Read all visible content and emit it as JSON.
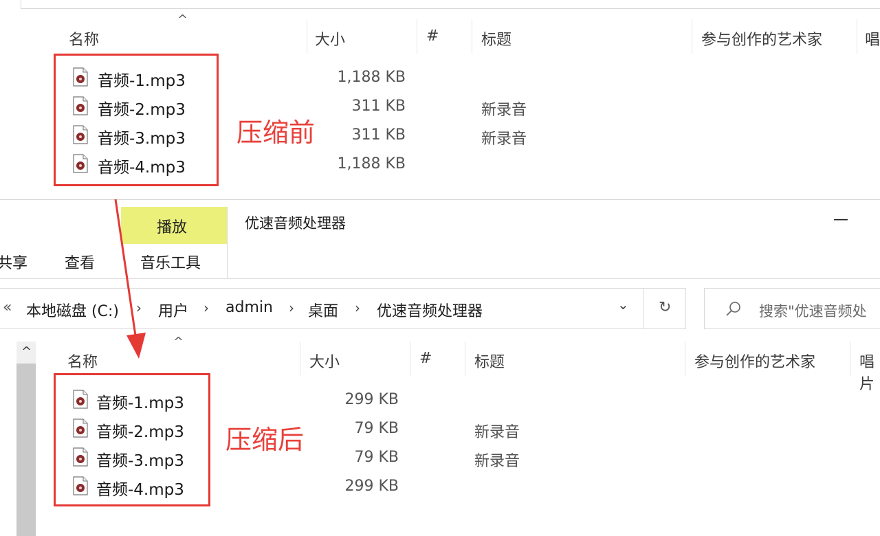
{
  "top_window": {
    "columns": {
      "name": "名称",
      "size": "大小",
      "number": "#",
      "title": "标题",
      "artist": "参与创作的艺术家",
      "extra": "唱"
    },
    "sort_indicator": "^",
    "files": [
      {
        "name": "音频-1.mp3",
        "size": "1,188 KB",
        "title": ""
      },
      {
        "name": "音频-2.mp3",
        "size": "311 KB",
        "title": "新录音"
      },
      {
        "name": "音频-3.mp3",
        "size": "311 KB",
        "title": "新录音"
      },
      {
        "name": "音频-4.mp3",
        "size": "1,188 KB",
        "title": ""
      }
    ],
    "annotation": "压缩前"
  },
  "bottom_window": {
    "ribbon": {
      "play_tab": "播放",
      "window_title": "优速音频处理器",
      "minimize": "—",
      "share_tab": "共享",
      "view_tab": "查看",
      "music_tools_tab": "音乐工具"
    },
    "address_bar": {
      "back_chevrons": "«",
      "path": [
        "本地磁盘 (C:)",
        "用户",
        "admin",
        "桌面",
        "优速音频处理器"
      ],
      "separator": "›",
      "dropdown": "⌄",
      "refresh": "↻"
    },
    "search": {
      "placeholder": "搜索\"优速音频处"
    },
    "columns": {
      "name": "名称",
      "size": "大小",
      "number": "#",
      "title": "标题",
      "artist": "参与创作的艺术家",
      "extra": "唱片"
    },
    "sort_indicator": "^",
    "scroll_up": "^",
    "files": [
      {
        "name": "音频-1.mp3",
        "size": "299 KB",
        "title": ""
      },
      {
        "name": "音频-2.mp3",
        "size": "79 KB",
        "title": "新录音"
      },
      {
        "name": "音频-3.mp3",
        "size": "79 KB",
        "title": "新录音"
      },
      {
        "name": "音频-4.mp3",
        "size": "299 KB",
        "title": ""
      }
    ],
    "annotation": "压缩后"
  },
  "colors": {
    "annotation_red": "#e8413a",
    "highlight_tab": "#eaf07a",
    "icon_dark_red": "#8b2b2b"
  }
}
